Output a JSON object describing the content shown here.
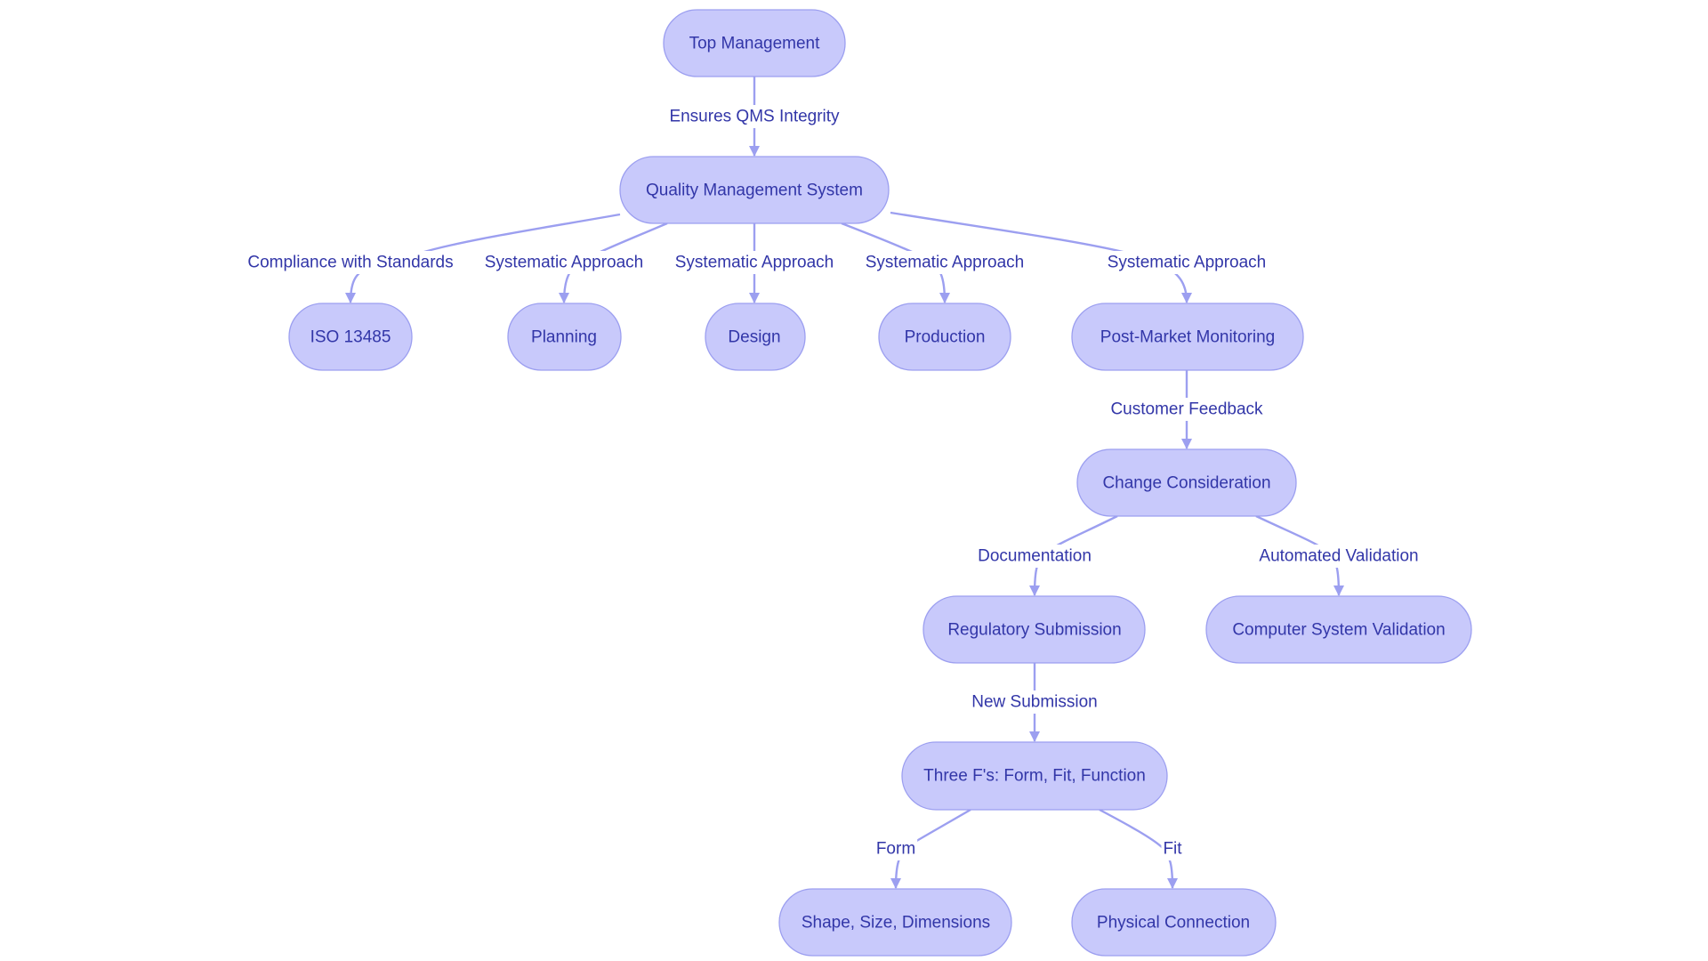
{
  "diagram": {
    "type": "flowchart",
    "colors": {
      "node_fill": "#c8c9fb",
      "node_stroke": "#9c9ff0",
      "text": "#3236a8",
      "edge": "#9c9ff0",
      "background": "#ffffff"
    },
    "nodes": [
      {
        "id": "top",
        "label": "Top Management"
      },
      {
        "id": "qms",
        "label": "Quality Management System"
      },
      {
        "id": "iso",
        "label": "ISO 13485"
      },
      {
        "id": "planning",
        "label": "Planning"
      },
      {
        "id": "design",
        "label": "Design"
      },
      {
        "id": "production",
        "label": "Production"
      },
      {
        "id": "pmm",
        "label": "Post-Market Monitoring"
      },
      {
        "id": "change",
        "label": "Change Consideration"
      },
      {
        "id": "regsub",
        "label": "Regulatory Submission"
      },
      {
        "id": "csv",
        "label": "Computer System Validation"
      },
      {
        "id": "threef",
        "label": "Three F's: Form, Fit, Function"
      },
      {
        "id": "shape",
        "label": "Shape, Size, Dimensions"
      },
      {
        "id": "physical",
        "label": "Physical Connection"
      }
    ],
    "edges": [
      {
        "from": "top",
        "to": "qms",
        "label": "Ensures QMS Integrity"
      },
      {
        "from": "qms",
        "to": "iso",
        "label": "Compliance with Standards"
      },
      {
        "from": "qms",
        "to": "planning",
        "label": "Systematic Approach"
      },
      {
        "from": "qms",
        "to": "design",
        "label": "Systematic Approach"
      },
      {
        "from": "qms",
        "to": "production",
        "label": "Systematic Approach"
      },
      {
        "from": "qms",
        "to": "pmm",
        "label": "Systematic Approach"
      },
      {
        "from": "pmm",
        "to": "change",
        "label": "Customer Feedback"
      },
      {
        "from": "change",
        "to": "regsub",
        "label": "Documentation"
      },
      {
        "from": "change",
        "to": "csv",
        "label": "Automated Validation"
      },
      {
        "from": "regsub",
        "to": "threef",
        "label": "New Submission"
      },
      {
        "from": "threef",
        "to": "shape",
        "label": "Form"
      },
      {
        "from": "threef",
        "to": "physical",
        "label": "Fit"
      }
    ]
  }
}
